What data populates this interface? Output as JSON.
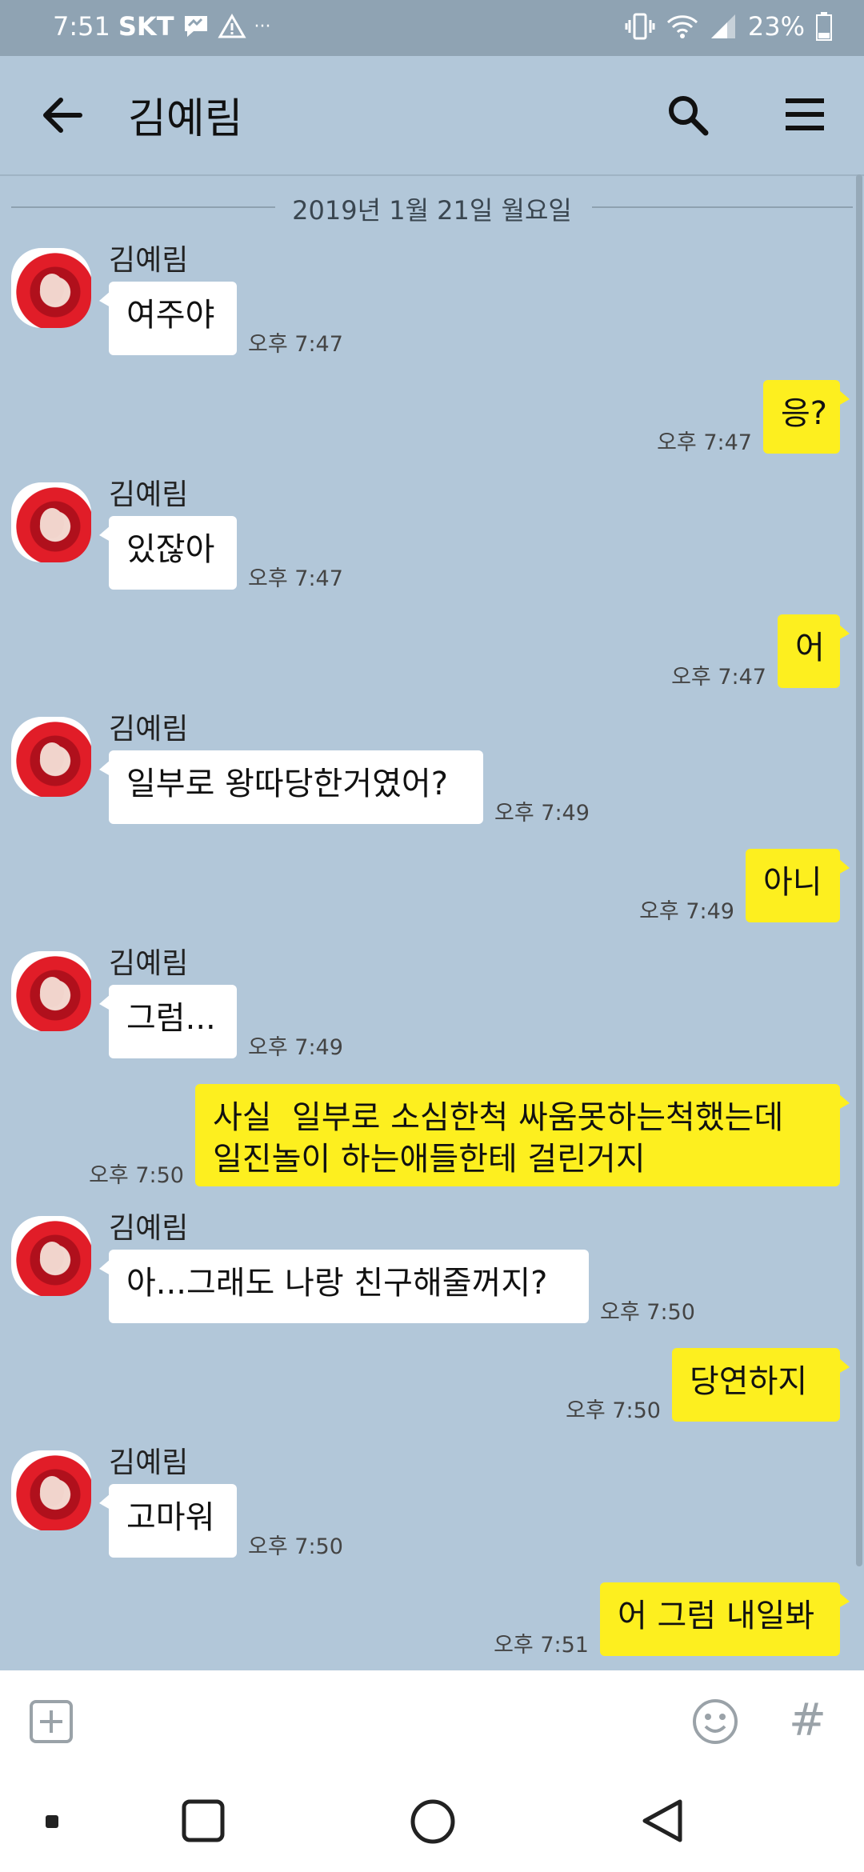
{
  "status_bar": {
    "time": "7:51",
    "carrier": "SKT",
    "battery": "23%",
    "dots": "···"
  },
  "header": {
    "title": "김예림"
  },
  "chat": {
    "date": "2019년 1월 21일 월요일",
    "sender_name": "김예림",
    "messages": [
      {
        "dir": "in",
        "text": "여주야",
        "time": "오후 7:47"
      },
      {
        "dir": "out",
        "text": "응?",
        "time": "오후 7:47"
      },
      {
        "dir": "in",
        "text": "있잖아",
        "time": "오후 7:47"
      },
      {
        "dir": "out",
        "text": "어",
        "time": "오후 7:47"
      },
      {
        "dir": "in",
        "text": "일부로 왕따당한거였어?",
        "time": "오후 7:49"
      },
      {
        "dir": "out",
        "text": "아니",
        "time": "오후 7:49"
      },
      {
        "dir": "in",
        "text": "그럼...",
        "time": "오후 7:49"
      },
      {
        "dir": "out",
        "text": "사실  일부로 소심한척 싸움못하는척했는데\n일진놀이 하는애들한테 걸린거지",
        "time": "오후 7:50"
      },
      {
        "dir": "in",
        "text": "아...그래도 나랑 친구해줄꺼지?",
        "time": "오후 7:50"
      },
      {
        "dir": "out",
        "text": "당연하지",
        "time": "오후 7:50"
      },
      {
        "dir": "in",
        "text": "고마워",
        "time": "오후 7:50"
      },
      {
        "dir": "out",
        "text": "어 그럼 내일봐",
        "time": "오후 7:51"
      }
    ]
  },
  "input_bar": {
    "hash_label": "#"
  },
  "icons": {
    "back": "arrow-left-icon",
    "search": "search-icon",
    "menu": "hamburger-menu-icon",
    "plus": "plus-square-icon",
    "emoji": "smiley-icon",
    "nav_recent": "square-icon",
    "nav_home": "circle-icon",
    "nav_back": "triangle-back-icon"
  },
  "colors": {
    "chat_background": "#b2c7d9",
    "incoming_bubble": "#ffffff",
    "outgoing_bubble": "#fdef1f",
    "status_bar": "#8fa3b3"
  }
}
